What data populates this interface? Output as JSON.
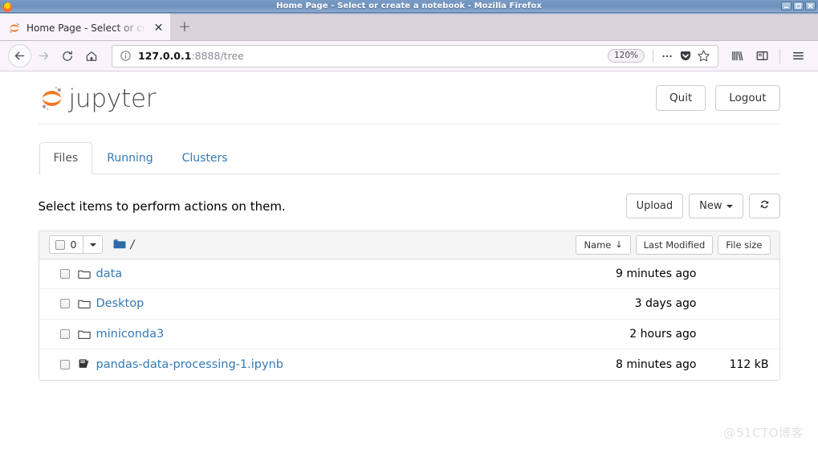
{
  "window": {
    "title": "Home Page - Select or create a notebook - Mozilla Firefox",
    "minimize_label": "−",
    "maximize_label": "□",
    "close_label": "✕",
    "app_icon": "firefox-logo"
  },
  "browser": {
    "tab": {
      "title": "Home Page - Select or cre",
      "favicon": "jupyter-favicon",
      "close_label": "✕"
    },
    "new_tab_label": "+",
    "nav": {
      "back_icon": "back-arrow-icon",
      "forward_icon": "forward-arrow-icon",
      "reload_icon": "reload-icon",
      "home_icon": "home-icon"
    },
    "urlbar": {
      "info_icon": "page-info-icon",
      "host": "127.0.0.1",
      "path": ":8888/tree",
      "full_url": "127.0.0.1:8888/tree",
      "zoom_level": "120%",
      "page_actions_icon": "ellipsis-icon",
      "pocket_icon": "pocket-icon",
      "bookmark_icon": "star-icon"
    },
    "toolbar": {
      "library_icon": "library-icon",
      "sidebar_icon": "sidebar-icon",
      "menu_icon": "hamburger-menu-icon"
    }
  },
  "jupyter": {
    "logo_text": "jupyter",
    "logo_icon": "jupyter-logo-icon",
    "quit_label": "Quit",
    "logout_label": "Logout",
    "tabs": [
      {
        "label": "Files",
        "active": true
      },
      {
        "label": "Running",
        "active": false
      },
      {
        "label": "Clusters",
        "active": false
      }
    ],
    "action_text": "Select items to perform actions on them.",
    "upload_label": "Upload",
    "new_label": "New",
    "refresh_icon": "refresh-icon",
    "filelist": {
      "select_count": "0",
      "select_checkbox_icon": "checkbox-icon",
      "select_dropdown_icon": "caret-down-icon",
      "breadcrumb_folder_icon": "folder-filled-icon",
      "breadcrumb_path": "/",
      "columns": {
        "name": "Name",
        "name_sort_arrow": "↓",
        "last_modified": "Last Modified",
        "file_size": "File size"
      },
      "rows": [
        {
          "name": "data",
          "type": "folder",
          "icon": "folder-icon",
          "last_modified": "9 minutes ago",
          "size": ""
        },
        {
          "name": "Desktop",
          "type": "folder",
          "icon": "folder-icon",
          "last_modified": "3 days ago",
          "size": ""
        },
        {
          "name": "miniconda3",
          "type": "folder",
          "icon": "folder-icon",
          "last_modified": "2 hours ago",
          "size": ""
        },
        {
          "name": "pandas-data-processing-1.ipynb",
          "type": "notebook",
          "icon": "notebook-icon",
          "last_modified": "8 minutes ago",
          "size": "112 kB"
        }
      ]
    }
  },
  "watermark": "@51CTO博客",
  "colors": {
    "link": "#337ab7",
    "jupyter_orange": "#f37726",
    "titlebar_blue": "#6f93bf",
    "folder_blue": "#2c6ba8"
  }
}
